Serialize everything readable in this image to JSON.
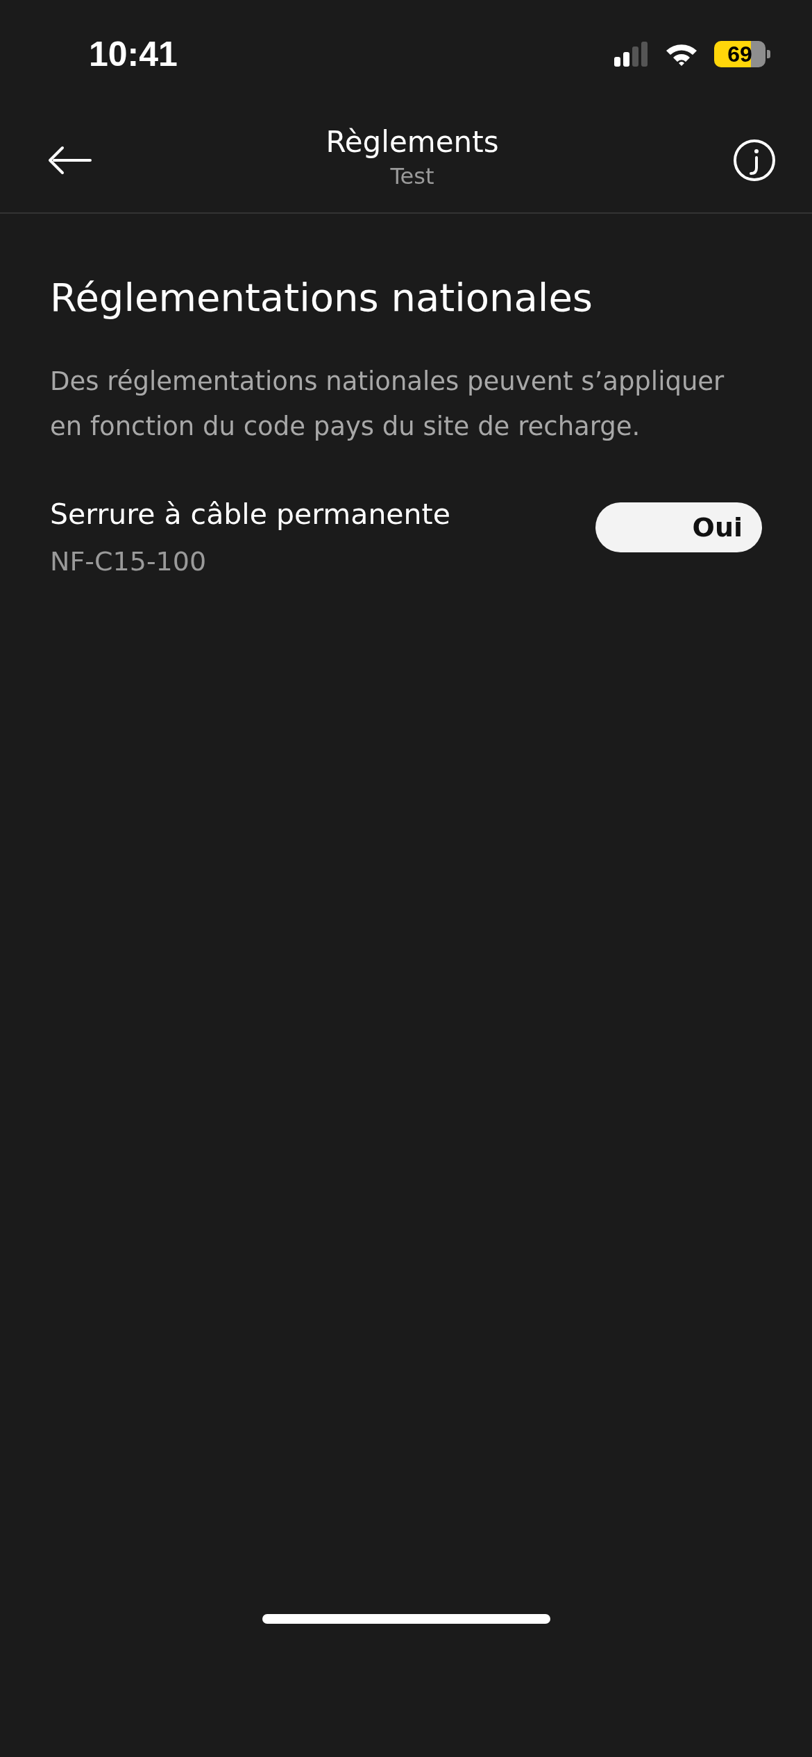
{
  "status_bar": {
    "time": "10:41",
    "battery": "69"
  },
  "header": {
    "title": "Règlements",
    "subtitle": "Test"
  },
  "section": {
    "title": "Réglementations nationales",
    "description": "Des réglementations nationales peuvent s’appliquer en fonction du code pays du site de recharge."
  },
  "settings": [
    {
      "label": "Serrure à câble permanente",
      "detail": "NF-C15-100",
      "value": "Oui",
      "on": true
    }
  ]
}
